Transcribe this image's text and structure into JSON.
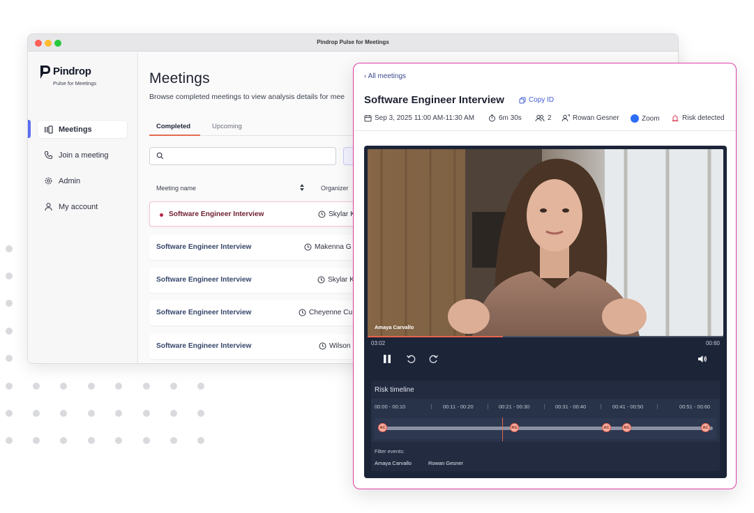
{
  "window": {
    "title": "Pindrop Pulse for Meetings"
  },
  "brand": {
    "name": "Pindrop",
    "tagline": "Pulse for Meetings"
  },
  "sidebar": {
    "items": [
      {
        "label": "Meetings",
        "icon": "meetings-icon",
        "active": true
      },
      {
        "label": "Join a meeting",
        "icon": "phone-icon",
        "active": false
      },
      {
        "label": "Admin",
        "icon": "gear-icon",
        "active": false
      },
      {
        "label": "My account",
        "icon": "user-icon",
        "active": false
      }
    ]
  },
  "meetings_page": {
    "title": "Meetings",
    "subtitle": "Browse completed meetings to view analysis details for mee",
    "tabs": [
      {
        "label": "Completed",
        "active": true
      },
      {
        "label": "Upcoming",
        "active": false
      }
    ],
    "search": {
      "placeholder": "",
      "value": ""
    },
    "columns": [
      "Meeting name",
      "Organizer"
    ],
    "rows": [
      {
        "name": "Software Engineer Interview",
        "organizer": "Skylar K",
        "active": true
      },
      {
        "name": "Software Engineer Interview",
        "organizer": "Makenna G",
        "active": false
      },
      {
        "name": "Software Engineer Interview",
        "organizer": "Skylar K",
        "active": false
      },
      {
        "name": "Software Engineer Interview",
        "organizer": "Cheyenne Cu",
        "active": false
      },
      {
        "name": "Software Engineer Interview",
        "organizer": "Wilson",
        "active": false
      }
    ]
  },
  "detail": {
    "back_label": "All meetings",
    "title": "Software Engineer Interview",
    "copy_label": "Copy ID",
    "meta": {
      "date": "Sep 3, 2025 11:00 AM-11:30 AM",
      "duration": "6m 30s",
      "participants": "2",
      "host": "Rowan Gesner",
      "platform": "Zoom",
      "risk": "Risk detected"
    },
    "player": {
      "speaker": "Amaya Carvallo",
      "current_time": "03:02",
      "end_time": "00:60",
      "progress": 0.38
    },
    "risk_timeline": {
      "title": "Risk timeline",
      "ticks": [
        "00:00 - 00:10",
        "00:11 - 00:20",
        "00:21 - 00:30",
        "00:31 - 00:40",
        "00:41 - 00:50",
        "00:51 - 00:60"
      ],
      "markers": [
        {
          "label": "AC",
          "position": 0.0
        },
        {
          "label": "RG",
          "position": 0.395
        },
        {
          "label": "AC",
          "position": 0.67
        },
        {
          "label": "RG",
          "position": 0.73
        },
        {
          "label": "AC",
          "position": 0.965
        }
      ],
      "filter_label": "Filter events:",
      "filters": [
        "Amaya Carvallo",
        "Rowan Gesner"
      ]
    }
  },
  "colors": {
    "accent": "#e5654e",
    "panel_border": "#dd3fa4",
    "link": "#3f5bd4",
    "player_bg": "#1c2437",
    "nav_indicator": "#5b6cf2"
  }
}
